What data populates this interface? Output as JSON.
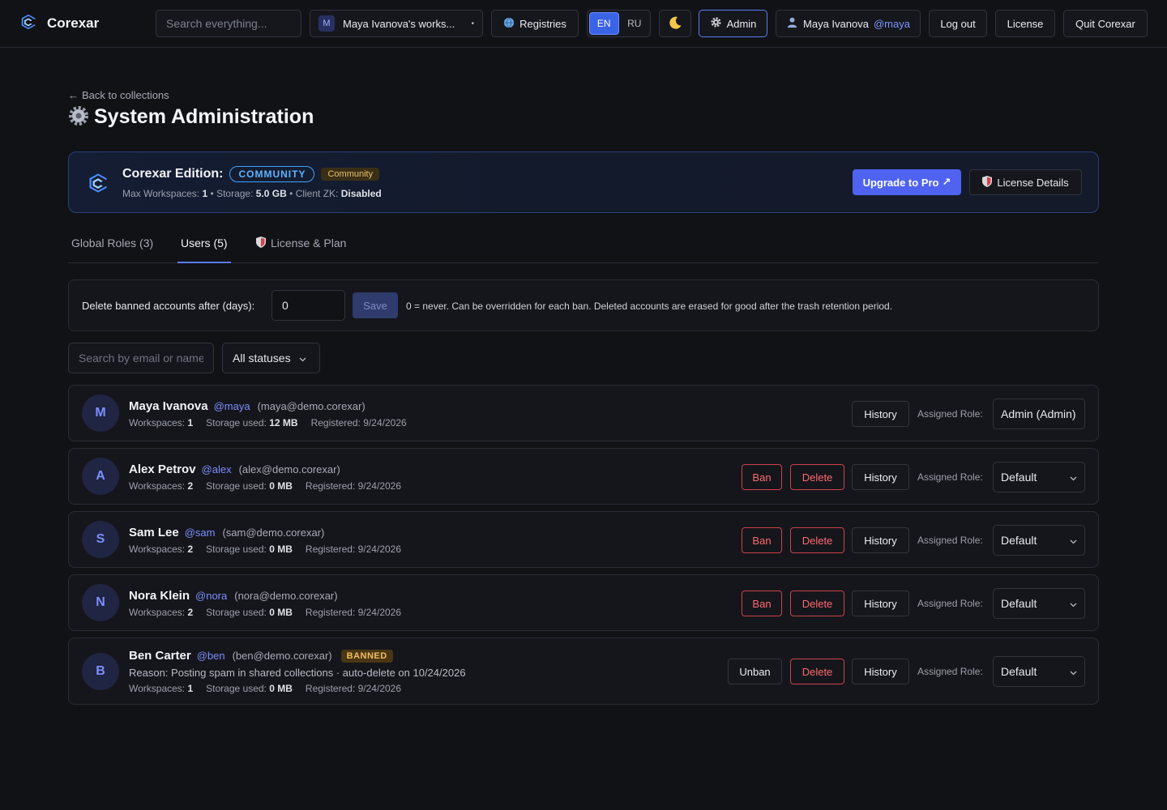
{
  "app": {
    "name": "Corexar"
  },
  "topbar": {
    "search_placeholder": "Search everything...",
    "workspace_initial": "M",
    "workspace_name": "Maya Ivanova's works...",
    "registries": "Registries",
    "lang_en": "EN",
    "lang_ru": "RU",
    "admin": "Admin",
    "user_name": "Maya Ivanova",
    "user_handle": "@maya",
    "logout": "Log out",
    "license": "License",
    "quit": "Quit Corexar"
  },
  "header": {
    "back": "Back to collections",
    "title": "System Administration"
  },
  "edition": {
    "title": "Corexar Edition:",
    "badge": "COMMUNITY",
    "tier": "Community",
    "max_ws_label": "Max Workspaces:",
    "max_ws_value": "1",
    "storage_label": "Storage:",
    "storage_value": "5.0 GB",
    "zk_label": "Client ZK:",
    "zk_value": "Disabled",
    "upgrade": "Upgrade to Pro",
    "license_details": "License Details"
  },
  "tabs": {
    "roles": "Global Roles (3)",
    "users": "Users (5)",
    "license": "License & Plan"
  },
  "retention": {
    "label": "Delete banned accounts after (days):",
    "value": "0",
    "save": "Save",
    "hint": "0 = never. Can be overridden for each ban. Deleted accounts are erased for good after the trash retention period."
  },
  "filters": {
    "search_placeholder": "Search by email or name",
    "status": "All statuses"
  },
  "labels": {
    "workspaces": "Workspaces:",
    "storage_used": "Storage used:",
    "registered": "Registered:",
    "assigned_role": "Assigned Role:",
    "ban": "Ban",
    "unban": "Unban",
    "delete": "Delete",
    "history": "History"
  },
  "users": [
    {
      "initial": "M",
      "name": "Maya Ivanova",
      "handle": "@maya",
      "email": "(maya@demo.corexar)",
      "workspaces": "1",
      "storage": "12 MB",
      "registered": "9/24/2026",
      "role": "Admin (Admin)"
    },
    {
      "initial": "A",
      "name": "Alex Petrov",
      "handle": "@alex",
      "email": "(alex@demo.corexar)",
      "workspaces": "2",
      "storage": "0 MB",
      "registered": "9/24/2026",
      "role": "Default"
    },
    {
      "initial": "S",
      "name": "Sam Lee",
      "handle": "@sam",
      "email": "(sam@demo.corexar)",
      "workspaces": "2",
      "storage": "0 MB",
      "registered": "9/24/2026",
      "role": "Default"
    },
    {
      "initial": "N",
      "name": "Nora Klein",
      "handle": "@nora",
      "email": "(nora@demo.corexar)",
      "workspaces": "2",
      "storage": "0 MB",
      "registered": "9/24/2026",
      "role": "Default"
    },
    {
      "initial": "B",
      "name": "Ben Carter",
      "handle": "@ben",
      "email": "(ben@demo.corexar)",
      "badge": "BANNED",
      "reason": "Reason: Posting spam in shared collections · auto-delete on 10/24/2026",
      "workspaces": "1",
      "storage": "0 MB",
      "registered": "9/24/2026",
      "role": "Default"
    }
  ],
  "icons": {
    "brand": "corexar-logo",
    "globe": "globe-icon",
    "moon": "moon-icon",
    "gear": "gear-icon",
    "user": "user-icon",
    "shield": "shield-icon",
    "chevron": "chevron-down-icon",
    "arrow": "arrow-left-icon",
    "external": "external-link-icon"
  },
  "colors": {
    "accent": "#4f63f0",
    "danger": "#ff6a70",
    "handle": "#7b8fff",
    "community": "#5eb4ff",
    "banned": "#f1c062"
  }
}
